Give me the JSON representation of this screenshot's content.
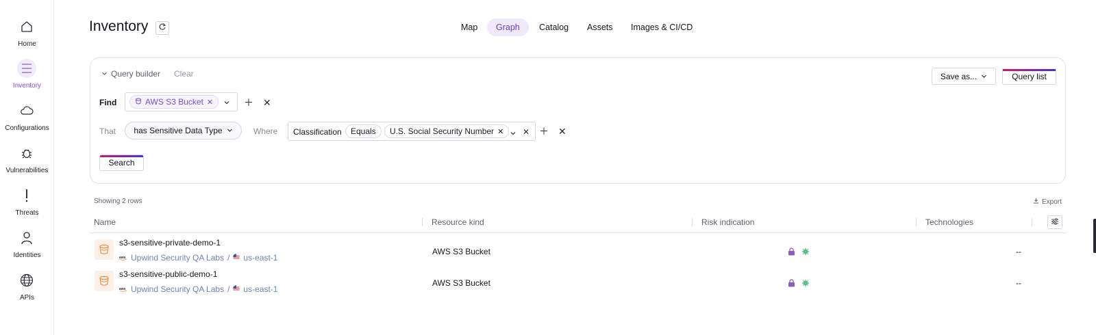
{
  "sidebar": {
    "items": [
      {
        "label": "Home",
        "icon": "home-icon"
      },
      {
        "label": "Inventory",
        "icon": "menu-icon",
        "active": true
      },
      {
        "label": "Configurations",
        "icon": "cloud-icon"
      },
      {
        "label": "Vulnerabilities",
        "icon": "bug-icon"
      },
      {
        "label": "Threats",
        "icon": "exclamation-icon"
      },
      {
        "label": "Identities",
        "icon": "person-icon"
      },
      {
        "label": "APIs",
        "icon": "globe-icon"
      }
    ]
  },
  "header": {
    "title": "Inventory",
    "refresh_icon": "refresh-icon"
  },
  "tabs": [
    {
      "label": "Map"
    },
    {
      "label": "Graph",
      "active": true
    },
    {
      "label": "Catalog"
    },
    {
      "label": "Assets"
    },
    {
      "label": "Images & CI/CD"
    }
  ],
  "query": {
    "builder_label": "Query builder",
    "clear_label": "Clear",
    "save_as_label": "Save as...",
    "query_list_label": "Query list",
    "find_label": "Find",
    "find_value": "AWS S3 Bucket",
    "that_label": "That",
    "relation_value": "has Sensitive Data Type",
    "where_label": "Where",
    "condition_field": "Classification",
    "condition_operator": "Equals",
    "condition_value": "U.S. Social Security Number",
    "search_label": "Search"
  },
  "results": {
    "showing": "Showing 2 rows",
    "export_label": "Export",
    "columns": [
      "Name",
      "Resource kind",
      "Risk indication",
      "Technologies"
    ],
    "rows": [
      {
        "name": "s3-sensitive-private-demo-1",
        "account": "Upwind Security QA Labs",
        "separator": "/",
        "region": "us-east-1",
        "kind": "AWS S3 Bucket",
        "risk": [
          "lock-icon",
          "data-sensitive-icon"
        ],
        "technologies": "--"
      },
      {
        "name": "s3-sensitive-public-demo-1",
        "account": "Upwind Security QA Labs",
        "separator": "/",
        "region": "us-east-1",
        "kind": "AWS S3 Bucket",
        "risk": [
          "lock-icon",
          "data-sensitive-icon"
        ],
        "technologies": "--"
      }
    ]
  },
  "colors": {
    "accent": "#7a4fc9",
    "accent_bg": "#efe9fa",
    "bucket_orange": "#f08a3c",
    "lock_purple": "#8b5bc4",
    "sensitive_green": "#5fbf8a"
  }
}
